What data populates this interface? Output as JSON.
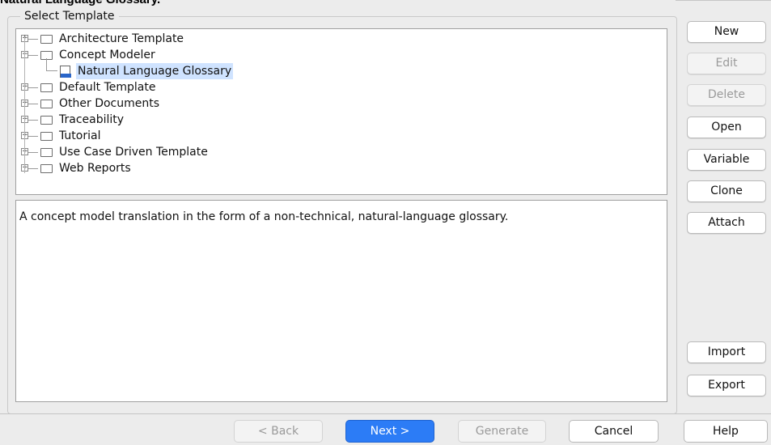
{
  "window": {
    "title": "Natural Language Glossary."
  },
  "group": {
    "legend": "Select Template"
  },
  "tree": {
    "items": [
      {
        "label": "Architecture Template",
        "expanded": false
      },
      {
        "label": "Concept Modeler",
        "expanded": true
      },
      {
        "label": "Natural Language Glossary",
        "selected": true,
        "icon": "html-file-icon"
      },
      {
        "label": "Default Template",
        "expanded": false
      },
      {
        "label": "Other Documents",
        "expanded": false
      },
      {
        "label": "Traceability",
        "expanded": false
      },
      {
        "label": "Tutorial",
        "expanded": false
      },
      {
        "label": "Use Case Driven Template",
        "expanded": false
      },
      {
        "label": "Web Reports",
        "expanded": false
      }
    ]
  },
  "description": {
    "text": "A concept model translation in the form of a non-technical, natural-language glossary."
  },
  "side_buttons": {
    "new": "New",
    "edit": "Edit",
    "delete": "Delete",
    "open": "Open",
    "variable": "Variable",
    "clone": "Clone",
    "attach": "Attach",
    "import": "Import",
    "export": "Export"
  },
  "bottom_buttons": {
    "back": "< Back",
    "next": "Next >",
    "generate": "Generate",
    "cancel": "Cancel",
    "help": "Help"
  },
  "colors": {
    "primary": "#2c7cf6",
    "selection": "#cfe3ff"
  }
}
